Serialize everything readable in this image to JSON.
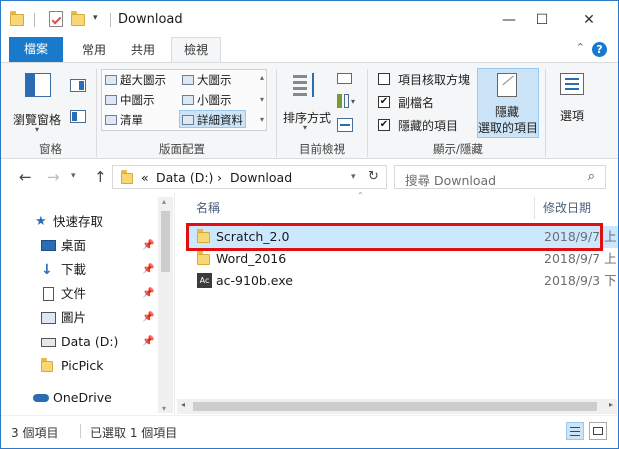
{
  "window": {
    "title": "Download",
    "minimize": "—",
    "maximize": "☐",
    "close": "✕"
  },
  "tabs": {
    "file": "檔案",
    "home": "常用",
    "share": "共用",
    "view": "檢視"
  },
  "ribbon": {
    "panes": {
      "nav_pane": "瀏覽窗格",
      "group": "窗格"
    },
    "layout": {
      "extra_large": "超大圖示",
      "large": "大圖示",
      "medium": "中圖示",
      "small": "小圖示",
      "list": "清單",
      "details": "詳細資料",
      "group": "版面配置"
    },
    "current_view": {
      "sort_by": "排序方式",
      "group": "目前檢視"
    },
    "show_hide": {
      "item_checkboxes": "項目核取方塊",
      "file_extensions": "副檔名",
      "hidden_items": "隱藏的項目",
      "hide_selected_line1": "隱藏",
      "hide_selected_line2": "選取的項目",
      "group": "顯示/隱藏",
      "checkbox_states": {
        "item_checkboxes": false,
        "file_extensions": true,
        "hidden_items": true
      }
    },
    "options": "選項"
  },
  "address": {
    "prefix": "«",
    "drive": "Data (D:)",
    "separator": "›",
    "folder": "Download",
    "search_placeholder": "搜尋 Download"
  },
  "sidebar": {
    "items": [
      {
        "label": "快速存取",
        "icon": "star-icon",
        "pinned": false
      },
      {
        "label": "桌面",
        "icon": "desktop-icon",
        "pinned": true
      },
      {
        "label": "下載",
        "icon": "download-arrow-icon",
        "pinned": true
      },
      {
        "label": "文件",
        "icon": "document-icon",
        "pinned": true
      },
      {
        "label": "圖片",
        "icon": "pictures-icon",
        "pinned": true
      },
      {
        "label": "Data (D:)",
        "icon": "drive-icon",
        "pinned": true
      },
      {
        "label": "PicPick",
        "icon": "folder-icon",
        "pinned": false
      },
      {
        "label": "OneDrive",
        "icon": "cloud-icon",
        "pinned": false
      }
    ]
  },
  "filelist": {
    "columns": {
      "name": "名稱",
      "date": "修改日期"
    },
    "files": [
      {
        "name": "Scratch_2.0",
        "date": "2018/9/7 上",
        "type": "folder",
        "selected": true
      },
      {
        "name": "Word_2016",
        "date": "2018/9/7 上",
        "type": "folder",
        "selected": false
      },
      {
        "name": "ac-910b.exe",
        "date": "2018/9/3 下",
        "type": "exe",
        "selected": false
      }
    ],
    "exe_icon_text": "Ac"
  },
  "status": {
    "item_count": "3 個項目",
    "selected": "已選取 1 個項目"
  },
  "colors": {
    "accent": "#1979ca",
    "selection": "#cce8ff",
    "highlight_box": "#e01010",
    "folder": "#f8d775"
  }
}
